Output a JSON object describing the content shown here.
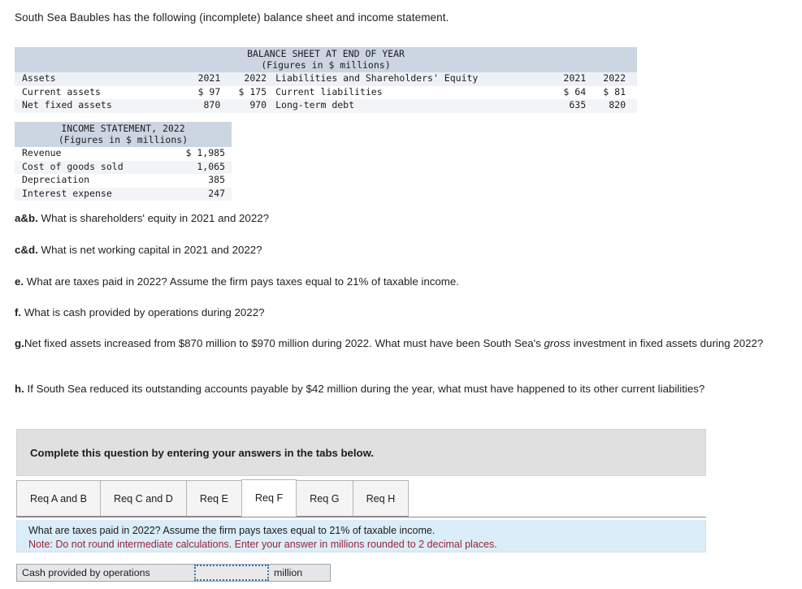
{
  "intro": "South Sea Baubles has the following (incomplete) balance sheet and income statement.",
  "balance_sheet": {
    "title": "BALANCE SHEET AT END OF YEAR",
    "subtitle": "(Figures in $ millions)",
    "headers": {
      "assets": "Assets",
      "year1": "2021",
      "year2": "2022",
      "liabilities": "Liabilities and Shareholders' Equity",
      "ryear1": "2021",
      "ryear2": "2022"
    },
    "rows": [
      {
        "asset_label": "Current assets",
        "asset_2021": "$ 97",
        "asset_2022": "$ 175",
        "liab_label": "Current liabilities",
        "liab_2021": "$ 64",
        "liab_2022": "$ 81"
      },
      {
        "asset_label": "Net fixed assets",
        "asset_2021": "870",
        "asset_2022": "970",
        "liab_label": "Long-term debt",
        "liab_2021": "635",
        "liab_2022": "820"
      }
    ]
  },
  "income_statement": {
    "title": "INCOME STATEMENT, 2022",
    "subtitle": "(Figures in $ millions)",
    "rows": [
      {
        "label": "Revenue",
        "value": "$ 1,985"
      },
      {
        "label": "Cost of goods sold",
        "value": "1,065"
      },
      {
        "label": "Depreciation",
        "value": "385"
      },
      {
        "label": "Interest expense",
        "value": "247"
      }
    ]
  },
  "questions": [
    {
      "id": "ab",
      "prefix": "a&b.",
      "text": " What is shareholders' equity in 2021 and 2022?"
    },
    {
      "id": "cd",
      "prefix": "c&d.",
      "text": " What is net working capital in 2021 and 2022?"
    },
    {
      "id": "e",
      "prefix": "e.",
      "text": " What are taxes paid in 2022? Assume the firm pays taxes equal to 21% of taxable income."
    },
    {
      "id": "f",
      "prefix": "f.",
      "text": " What is cash provided by operations during 2022?"
    },
    {
      "id": "g",
      "prefix": "g.",
      "text_part1": "Net fixed assets increased from $870 million to $970 million during 2022. What must have been South Sea's ",
      "italic": "gross",
      "text_part2": " investment in fixed assets during 2022?"
    },
    {
      "id": "h",
      "prefix": "h.",
      "text": " If South Sea reduced its outstanding accounts payable by $42 million during the year, what must have happened to its other current liabilities?"
    }
  ],
  "banner": {
    "text": "Complete this question by entering your answers in the tabs below."
  },
  "tabs": [
    {
      "label": "Req A and B",
      "active": false
    },
    {
      "label": "Req C and D",
      "active": false
    },
    {
      "label": "Req E",
      "active": false
    },
    {
      "label": "Req F",
      "active": true
    },
    {
      "label": "Req G",
      "active": false
    },
    {
      "label": "Req H",
      "active": false
    }
  ],
  "instruction": {
    "line1": "What are taxes paid in 2022? Assume the firm pays taxes equal to 21% of taxable income.",
    "line2": "Note: Do not round intermediate calculations. Enter your answer in millions rounded to 2 decimal places."
  },
  "answer": {
    "label": "Cash provided by operations",
    "value": "",
    "placeholder": "",
    "unit": "million"
  },
  "colors": {
    "table_header_band": "#ccd5e2",
    "table_col_header": "#eef1f5",
    "row_alt": "#f2f4f7",
    "banner_bg": "#e0e0e0",
    "instruction_bg": "#daedf8",
    "note_red": "#9b2335",
    "input_border_blue": "#3b6fb6"
  }
}
